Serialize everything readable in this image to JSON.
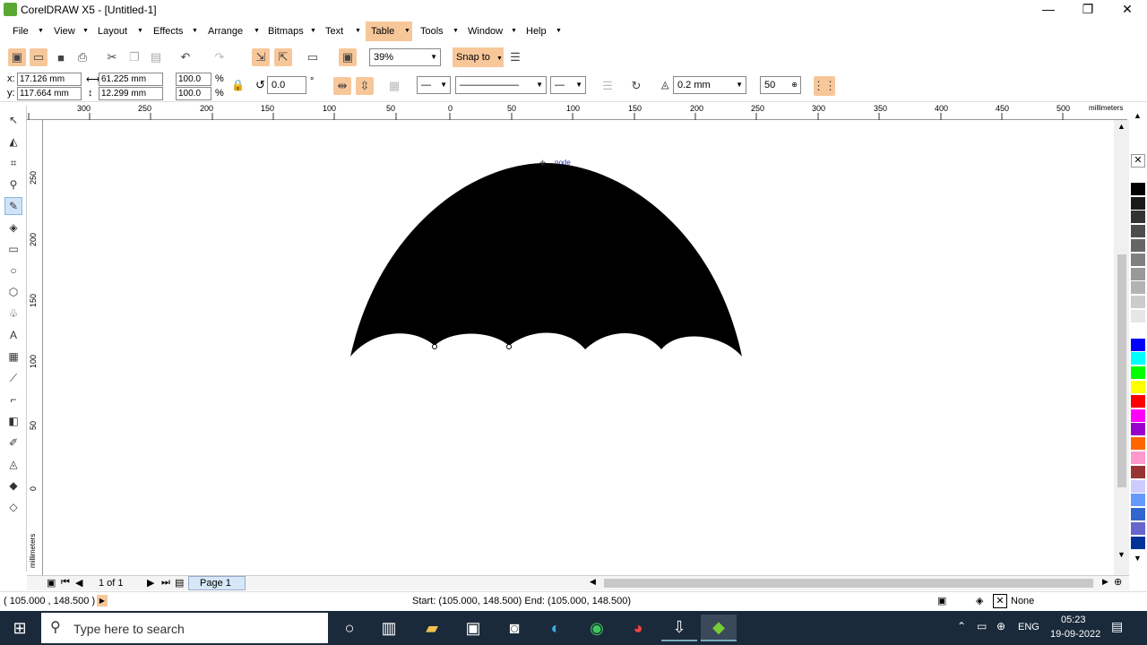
{
  "window": {
    "title": "CorelDRAW X5 - [Untitled-1]",
    "minimize": "—",
    "restore": "❐",
    "close": "✕"
  },
  "menus": [
    "File",
    "View",
    "Layout",
    "Effects",
    "Arrange",
    "Bitmaps",
    "Text",
    "Table",
    "Tools",
    "Window",
    "Help"
  ],
  "toolbar": {
    "zoom": "39%",
    "snap_to": "Snap to"
  },
  "property_bar": {
    "x": "17.126 mm",
    "y": "117.664 mm",
    "width": "61.225 mm",
    "height": "12.299 mm",
    "scale_x": "100.0",
    "scale_y": "100.0",
    "pct": "%",
    "rotation": "0.0",
    "degree": "°",
    "outline_width": "0.2 mm",
    "smoothing": "50"
  },
  "ruler": {
    "unit": "millimeters",
    "h_ticks": [
      "300",
      "250",
      "200",
      "150",
      "100",
      "50",
      "0",
      "50",
      "100",
      "150",
      "200",
      "250",
      "300",
      "350",
      "400",
      "450",
      "500"
    ],
    "v_ticks": [
      "250",
      "200",
      "150",
      "100",
      "50",
      "0"
    ]
  },
  "canvas": {
    "node_label": "node"
  },
  "page_nav": {
    "count": "1 of 1",
    "page_tab": "Page 1"
  },
  "status": {
    "coords": "( 105.000 , 148.500 )",
    "start_end": "Start: (105.000, 148.500)  End: (105.000, 148.500)",
    "fill_label": "None"
  },
  "palette_colors": [
    "#ffffff",
    "#000000",
    "#1a1a1a",
    "#333333",
    "#4d4d4d",
    "#666666",
    "#808080",
    "#999999",
    "#b3b3b3",
    "#cccccc",
    "#e6e6e6",
    "#ffffff",
    "#0000ff",
    "#00ffff",
    "#00ff00",
    "#ffff00",
    "#ff0000",
    "#ff00ff",
    "#9900cc",
    "#ff6600",
    "#ff99cc",
    "#993333",
    "#ccccff",
    "#6699ff",
    "#3366cc",
    "#6666cc",
    "#003399"
  ],
  "taskbar": {
    "search_placeholder": "Type here to search",
    "lang": "ENG",
    "time": "05:23",
    "date": "19-09-2022"
  }
}
